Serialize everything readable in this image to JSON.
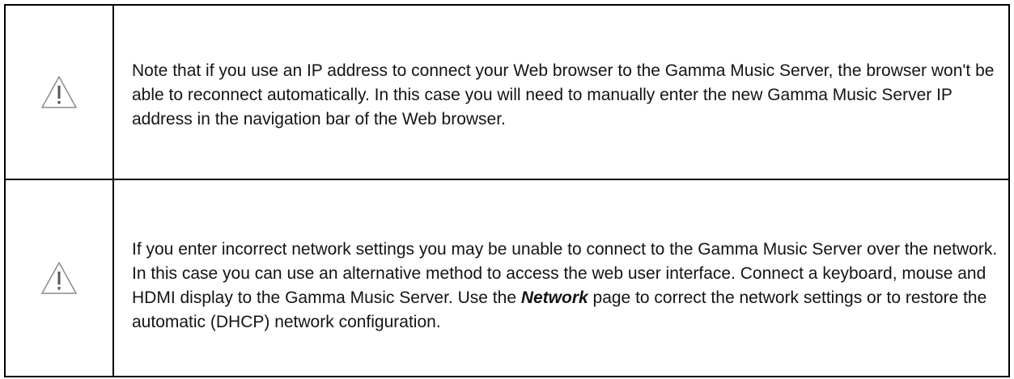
{
  "notes": [
    {
      "icon": "warning-triangle-icon",
      "text": "Note that if you use an IP address to connect your Web browser to the Gamma Music Server, the browser won't be able to reconnect automatically.  In this case you will need to manually enter the new Gamma Music Server IP address in the navigation bar of the Web browser."
    },
    {
      "icon": "warning-triangle-icon",
      "text_before": "If you enter incorrect network settings you may be unable to connect to the Gamma Music Server over the network.  In this case you can use an alternative method to access the web user interface. Connect a keyboard, mouse and HDMI display to the Gamma Music Server. Use the ",
      "emphasis": "Network",
      "text_after": " page to correct the network settings or to restore the automatic (DHCP) network configuration."
    }
  ]
}
